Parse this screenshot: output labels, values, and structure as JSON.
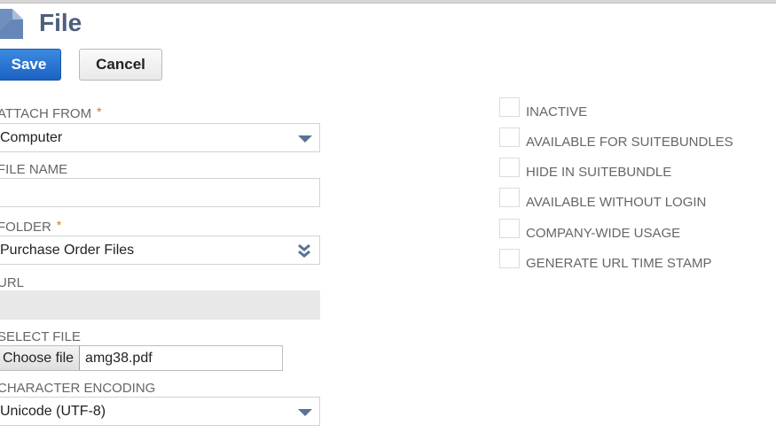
{
  "header": {
    "title": "File",
    "icon": "file-icon"
  },
  "toolbar": {
    "save_label": "Save",
    "cancel_label": "Cancel"
  },
  "form": {
    "attach_from": {
      "label": "ATTACH FROM",
      "required": "*",
      "value": "Computer"
    },
    "file_name": {
      "label": "FILE NAME",
      "value": ""
    },
    "folder": {
      "label": "FOLDER",
      "required": "*",
      "value": "Purchase Order Files"
    },
    "url": {
      "label": "URL",
      "value": ""
    },
    "select_file": {
      "label": "SELECT FILE",
      "button_label": "Choose file",
      "file_name": "amg38.pdf"
    },
    "character_encoding": {
      "label": "CHARACTER ENCODING",
      "value": "Unicode (UTF-8)"
    }
  },
  "checkboxes": [
    {
      "label": "INACTIVE",
      "checked": false
    },
    {
      "label": "AVAILABLE FOR SUITEBUNDLES",
      "checked": false
    },
    {
      "label": "HIDE IN SUITEBUNDLE",
      "checked": false
    },
    {
      "label": "AVAILABLE WITHOUT LOGIN",
      "checked": false
    },
    {
      "label": "COMPANY-WIDE USAGE",
      "checked": false
    },
    {
      "label": "GENERATE URL TIME STAMP",
      "checked": false
    }
  ],
  "colors": {
    "primary": "#1c62c4",
    "title": "#4d5f7c",
    "required": "#d07b1e",
    "arrow": "#5a7296"
  }
}
